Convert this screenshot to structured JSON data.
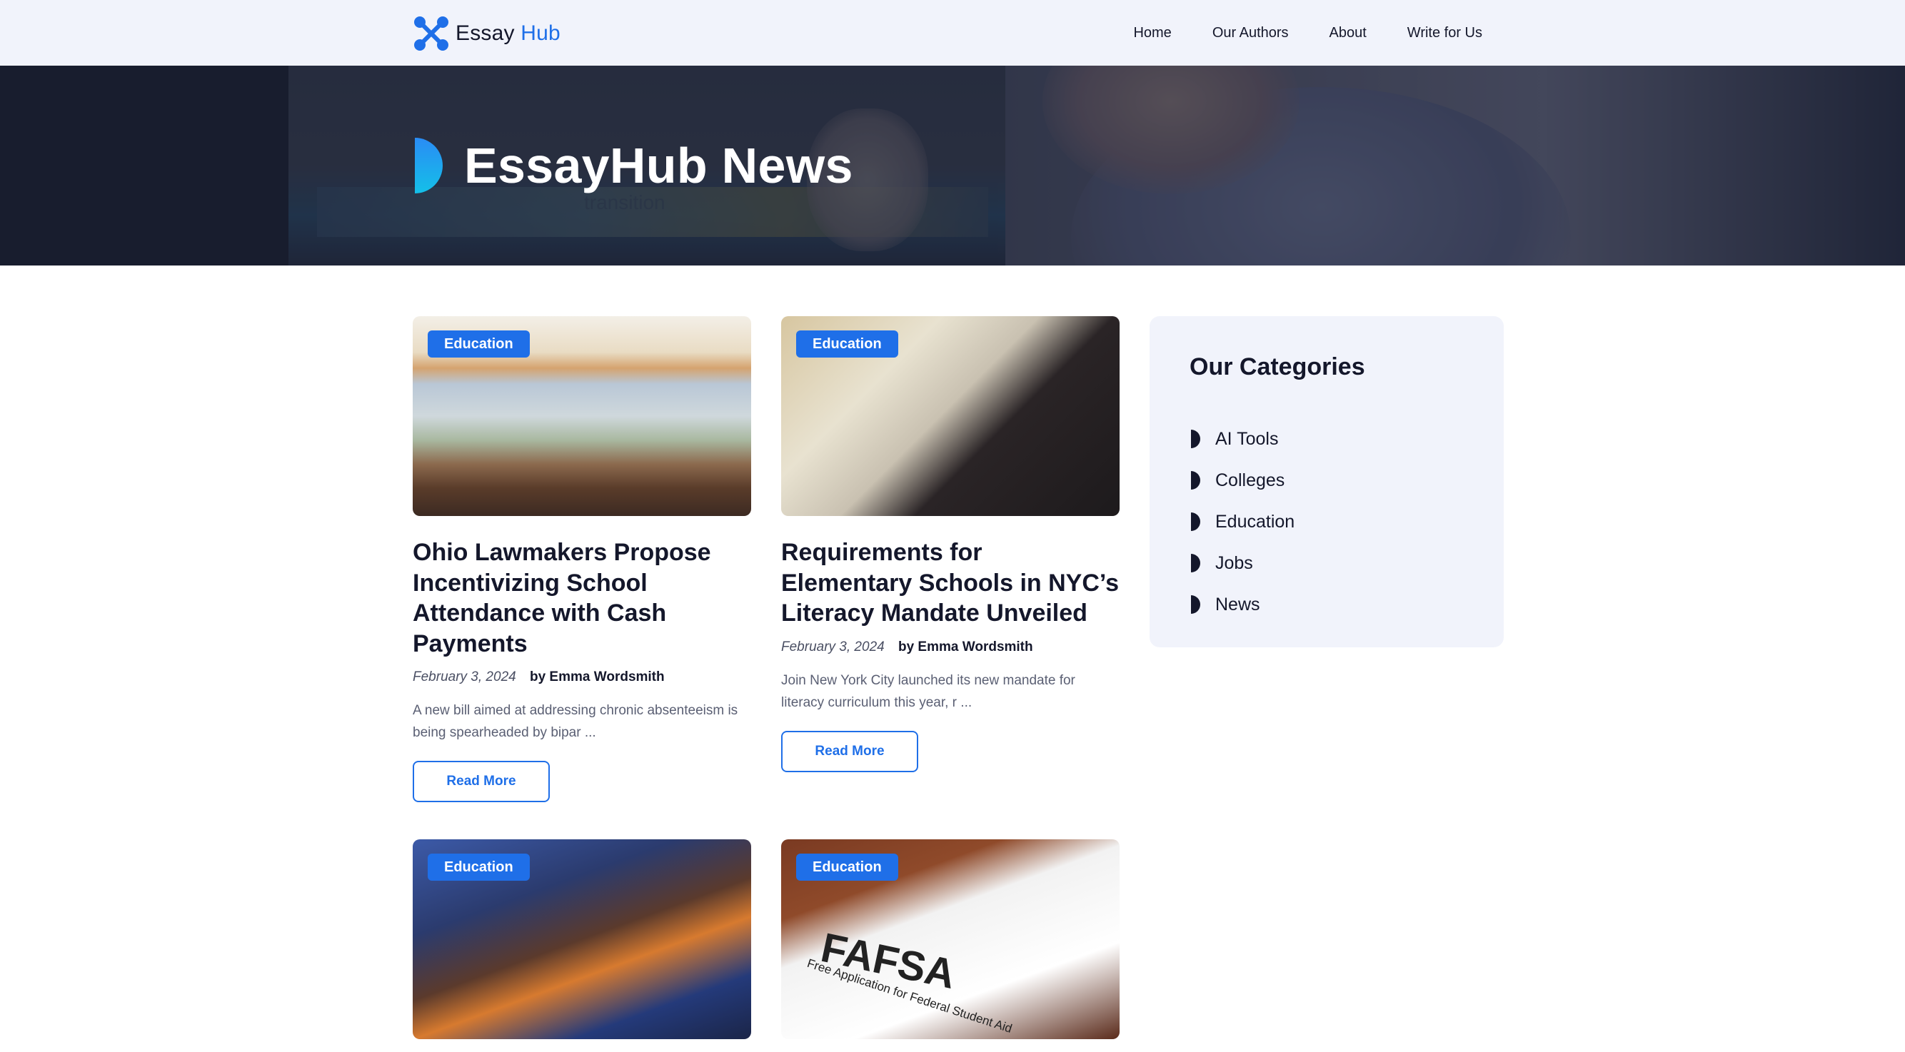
{
  "header": {
    "logo_text_1": "Essay",
    "logo_text_2": "Hub",
    "nav": [
      "Home",
      "Our Authors",
      "About",
      "Write for Us"
    ]
  },
  "hero": {
    "title": "EssayHub News",
    "background_word": "transition"
  },
  "articles": [
    {
      "category": "Education",
      "title": "Ohio Lawmakers Propose Incentivizing School Attendance with Cash Payments",
      "date": "February 3, 2024",
      "author": "by Emma Wordsmith",
      "excerpt": "A new bill aimed at addressing chronic absenteeism is being spearheaded by bipar ...",
      "read_more": "Read More"
    },
    {
      "category": "Education",
      "title": "Requirements for Elementary Schools in NYC’s Literacy Mandate Unveiled",
      "date": "February 3, 2024",
      "author": "by Emma Wordsmith",
      "excerpt": "Join New York City launched its new mandate for literacy curriculum this year, r ...",
      "read_more": "Read More"
    },
    {
      "category": "Education"
    },
    {
      "category": "Education",
      "image_text_1": "FAFSA",
      "image_text_2": "Free Application for Federal Student Aid"
    }
  ],
  "sidebar": {
    "title": "Our Categories",
    "categories": [
      "AI Tools",
      "Colleges",
      "Education",
      "Jobs",
      "News"
    ]
  },
  "colors": {
    "accent": "#1f6fe8",
    "dark_text": "#14172b",
    "light_panel": "#f1f3fb"
  },
  "icons": {
    "logo": "molecule-x-logo-icon",
    "hero_mark": "half-circle-gradient-icon",
    "category_bullet": "half-circle-bullet-icon"
  }
}
